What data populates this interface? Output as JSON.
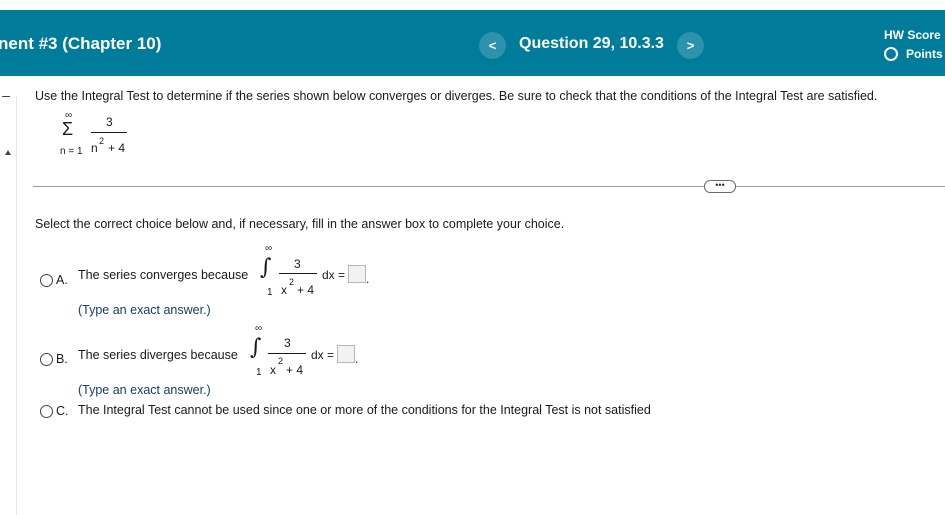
{
  "header": {
    "assignment_title": "nent #3 (Chapter 10)",
    "prev_label": "<",
    "next_label": ">",
    "question_title": "Question 29, 10.3.3",
    "hw_score_label": "HW Score",
    "points_label": "Points"
  },
  "question": {
    "instructions": "Use the Integral Test to determine if the series shown below converges or diverges. Be sure to check that the conditions of the Integral Test are satisfied.",
    "series": {
      "sigma": "Σ",
      "upper": "∞",
      "lower": "n = 1",
      "numerator": "3",
      "denominator_base": "n",
      "denominator_exp": "2",
      "denominator_rest": "+ 4"
    },
    "more_label": "•••",
    "select_prompt": "Select the correct choice below and, if necessary, fill in the answer box to complete your choice."
  },
  "choices": [
    {
      "letter": "A.",
      "text": "The series converges because",
      "integral": {
        "sign": "∫",
        "upper": "∞",
        "lower": "1",
        "numerator": "3",
        "denominator_base": "x",
        "denominator_exp": "2",
        "denominator_rest": "+ 4",
        "dx": "dx ="
      },
      "hint": "(Type an exact answer.)"
    },
    {
      "letter": "B.",
      "text": "The series diverges because",
      "integral": {
        "sign": "∫",
        "upper": "∞",
        "lower": "1",
        "numerator": "3",
        "denominator_base": "x",
        "denominator_exp": "2",
        "denominator_rest": "+ 4",
        "dx": "dx ="
      },
      "hint": "(Type an exact answer.)"
    },
    {
      "letter": "C.",
      "text": "The Integral Test cannot be used since one or more of the conditions for the Integral Test is not satisfied"
    }
  ],
  "colors": {
    "header_bg": "#007c9b",
    "nav_button_bg": "#2c92ad",
    "hint_text": "#1b3a6b"
  }
}
